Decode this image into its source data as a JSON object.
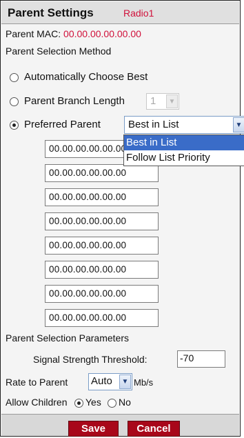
{
  "header": {
    "title": "Parent Settings",
    "radio_name": "Radio1"
  },
  "parent_mac": {
    "label": "Parent MAC:",
    "value": "00.00.00.00.00.00"
  },
  "selection_method": {
    "label": "Parent Selection Method",
    "auto_label": "Automatically Choose Best",
    "branch_label": "Parent Branch Length",
    "branch_value": "1",
    "preferred_label": "Preferred Parent",
    "preferred_selected": "Best in List",
    "selected_option": "preferred"
  },
  "dropdown": {
    "options": [
      "Best in List",
      "Follow List Priority"
    ],
    "highlighted": "Best in List"
  },
  "mac_list": [
    "00.00.00.00.00.00",
    "00.00.00.00.00.00",
    "00.00.00.00.00.00",
    "00.00.00.00.00.00",
    "00.00.00.00.00.00",
    "00.00.00.00.00.00",
    "00.00.00.00.00.00",
    "00.00.00.00.00.00"
  ],
  "parameters": {
    "label": "Parent Selection Parameters",
    "signal_label": "Signal Strength Threshold:",
    "signal_value": "-70"
  },
  "rate": {
    "label": "Rate to Parent",
    "value": "Auto",
    "unit": "Mb/s"
  },
  "children": {
    "label": "Allow Children",
    "yes": "Yes",
    "no": "No",
    "selected": "yes"
  },
  "footer": {
    "save_label": "Save",
    "cancel_label": "Cancel"
  },
  "colors": {
    "accent_red": "#d0103a",
    "button_red": "#a8071a",
    "highlight_blue": "#3a6cc8"
  }
}
